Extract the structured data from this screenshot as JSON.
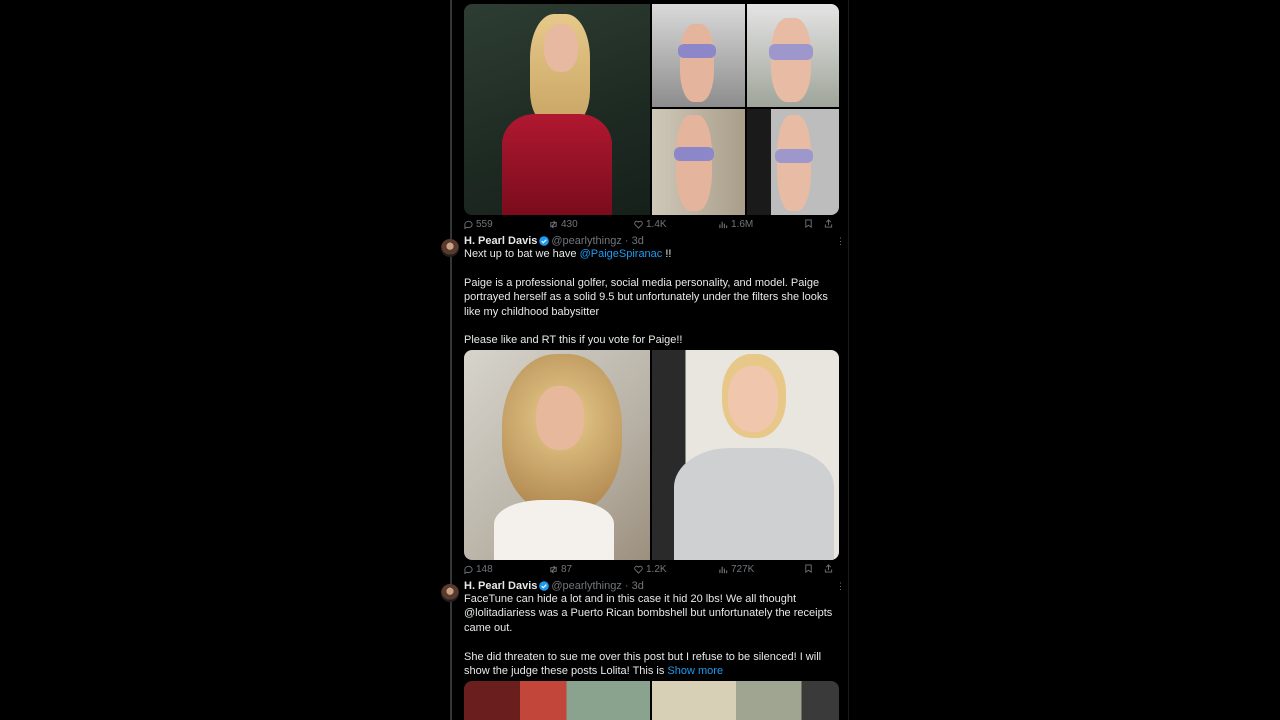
{
  "tweet1": {
    "stats": {
      "replies": "559",
      "retweets": "430",
      "likes": "1.4K",
      "views": "1.6M"
    }
  },
  "tweet2": {
    "name": "H. Pearl Davis",
    "handle": "@pearlythingz",
    "time": "3d",
    "more": "⋮",
    "line1_pre": "Next up to bat we have ",
    "line1_mention": "@PaigeSpiranac",
    "line1_post": " !!",
    "para2": "Paige is a professional golfer, social media personality, and model. Paige portrayed herself as a solid 9.5 but unfortunately under the filters she looks like my childhood babysitter",
    "para3": "Please like and RT this if you vote for Paige!!",
    "stats": {
      "replies": "148",
      "retweets": "87",
      "likes": "1.2K",
      "views": "727K"
    }
  },
  "tweet3": {
    "name": "H. Pearl Davis",
    "handle": "@pearlythingz",
    "time": "3d",
    "more": "⋮",
    "para1": "FaceTune can hide a lot and in this case it hid 20 lbs! We all thought @lolitadiariess was a Puerto Rican bombshell but unfortunately the receipts came out.",
    "para2": "She did  threaten to sue me over this post but I refuse to be silenced! I will show the judge these posts Lolita! This is ",
    "show_more": "Show more"
  },
  "colors": {
    "accent": "#1d9bf0",
    "muted": "#71767b",
    "text": "#e7e9ea",
    "bg": "#000000"
  }
}
